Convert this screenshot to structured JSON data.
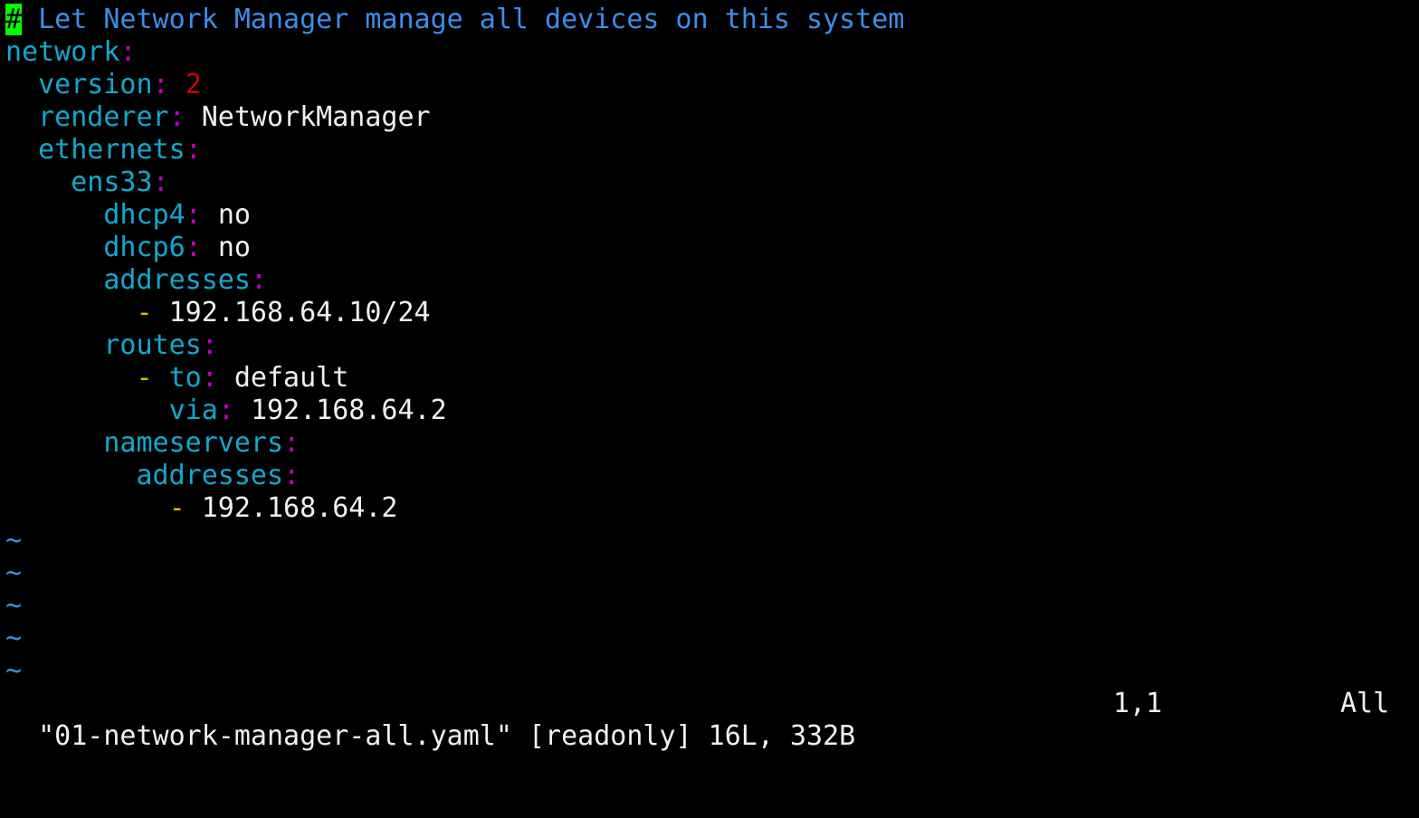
{
  "editor": {
    "comment_marker": "#",
    "comment_text": " Let Network Manager manage all devices on this system",
    "lines": [
      {
        "indent": "",
        "key": "network",
        "dash": "",
        "value": "",
        "value_type": "none"
      },
      {
        "indent": "  ",
        "key": "version",
        "dash": "",
        "value": "2",
        "value_type": "number"
      },
      {
        "indent": "  ",
        "key": "renderer",
        "dash": "",
        "value": "NetworkManager",
        "value_type": "string"
      },
      {
        "indent": "  ",
        "key": "ethernets",
        "dash": "",
        "value": "",
        "value_type": "none"
      },
      {
        "indent": "    ",
        "key": "ens33",
        "dash": "",
        "value": "",
        "value_type": "none"
      },
      {
        "indent": "      ",
        "key": "dhcp4",
        "dash": "",
        "value": "no",
        "value_type": "string"
      },
      {
        "indent": "      ",
        "key": "dhcp6",
        "dash": "",
        "value": "no",
        "value_type": "string"
      },
      {
        "indent": "      ",
        "key": "addresses",
        "dash": "",
        "value": "",
        "value_type": "none"
      },
      {
        "indent": "        ",
        "key": "",
        "dash": "-",
        "value": "192.168.64.10/24",
        "value_type": "string"
      },
      {
        "indent": "      ",
        "key": "routes",
        "dash": "",
        "value": "",
        "value_type": "none"
      },
      {
        "indent": "        ",
        "key": "to",
        "dash": "-",
        "value": "default",
        "value_type": "string"
      },
      {
        "indent": "          ",
        "key": "via",
        "dash": "",
        "value": "192.168.64.2",
        "value_type": "string"
      },
      {
        "indent": "      ",
        "key": "nameservers",
        "dash": "",
        "value": "",
        "value_type": "none"
      },
      {
        "indent": "        ",
        "key": "addresses",
        "dash": "",
        "value": "",
        "value_type": "none"
      },
      {
        "indent": "          ",
        "key": "",
        "dash": "-",
        "value": "192.168.64.2",
        "value_type": "string"
      }
    ],
    "empty_line_marker": "~",
    "empty_line_count": 5
  },
  "status_bar": {
    "file_info": "\"01-network-manager-all.yaml\" [readonly] 16L, 332B",
    "cursor_position": "1,1",
    "scroll_position": "All"
  },
  "colors": {
    "background": "#000000",
    "comment": "#3b8eea",
    "cursor": "#00ff00",
    "key": "#11a8cd",
    "colon": "#c000c0",
    "number": "#cd0000",
    "dash": "#e5b800",
    "value": "#f0f0f0"
  }
}
